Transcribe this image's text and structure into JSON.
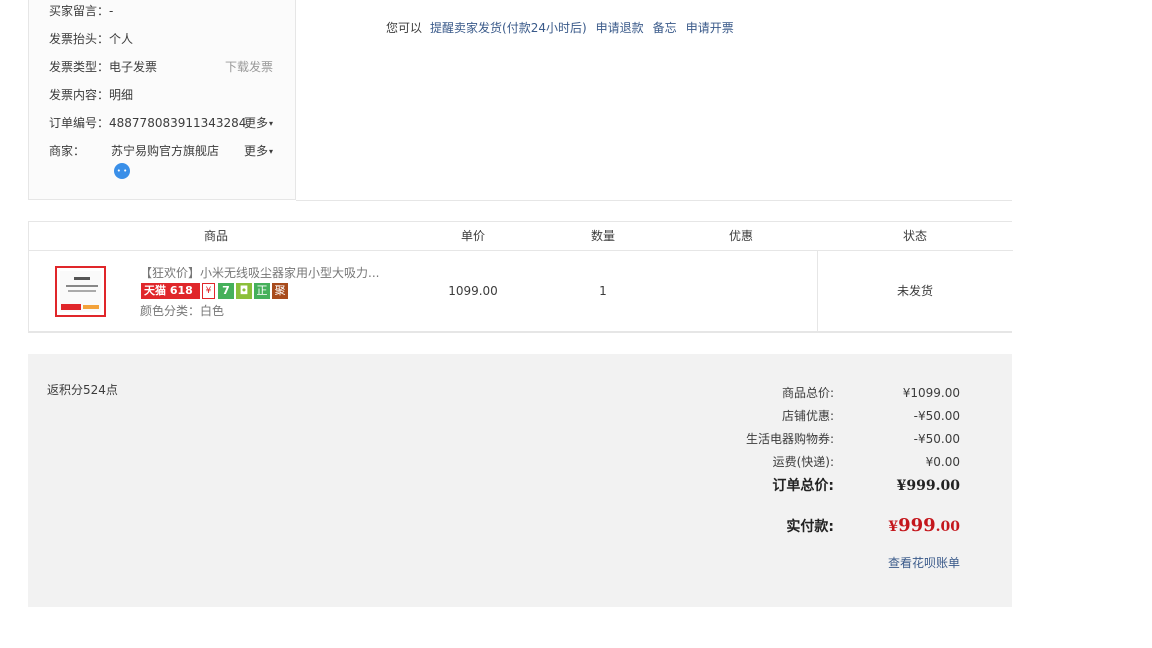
{
  "info": {
    "buyer_msg_label": "买家留言：",
    "buyer_msg_value": "-",
    "invoice_title_label": "发票抬头：",
    "invoice_title_value": "个人",
    "invoice_type_label": "发票类型：",
    "invoice_type_value": "电子发票",
    "download_invoice": "下载发票",
    "invoice_content_label": "发票内容：",
    "invoice_content_value": "明细",
    "order_no_label": "订单编号：",
    "order_no_value": "4887780839113432 84",
    "order_no_display": "488778083911343284",
    "merchant_label": "商家：",
    "merchant_value": "苏宁易购官方旗舰店",
    "more_label": "更多",
    "more_label_2": "更多",
    "wangwang_icon": "chat-bubble-icon"
  },
  "actions": {
    "lead": "您可以",
    "items": [
      "提醒卖家发货(付款24小时后)",
      "申请退款",
      "备忘",
      "申请开票"
    ]
  },
  "table": {
    "headers": [
      "商品",
      "单价",
      "数量",
      "优惠",
      "状态"
    ],
    "row": {
      "title": "【狂欢价】小米无线吸尘器家用小型大吸力...",
      "badge_tmall": "天猫 618",
      "badge_shield": "¥",
      "badge_seven": "7",
      "badge_zheng": "正",
      "badge_gift": "聚",
      "sku": "颜色分类：白色",
      "price": "1099.00",
      "qty": "1",
      "discount": "",
      "status": "未发货"
    }
  },
  "summary": {
    "points": "返积分524点",
    "rows": [
      {
        "label": "商品总价:",
        "value": "¥1099.00"
      },
      {
        "label": "店铺优惠:",
        "value": "-¥50.00"
      },
      {
        "label": "生活电器购物券:",
        "value": "-¥50.00"
      },
      {
        "label": "运费(快递):",
        "value": "¥0.00"
      }
    ],
    "order_total_label": "订单总价:",
    "order_total_value": "¥999.00",
    "paid_label": "实付款:",
    "paid_currency": "¥",
    "paid_int": "999",
    "paid_dec": ".00",
    "bill_link": "查看花呗账单"
  }
}
